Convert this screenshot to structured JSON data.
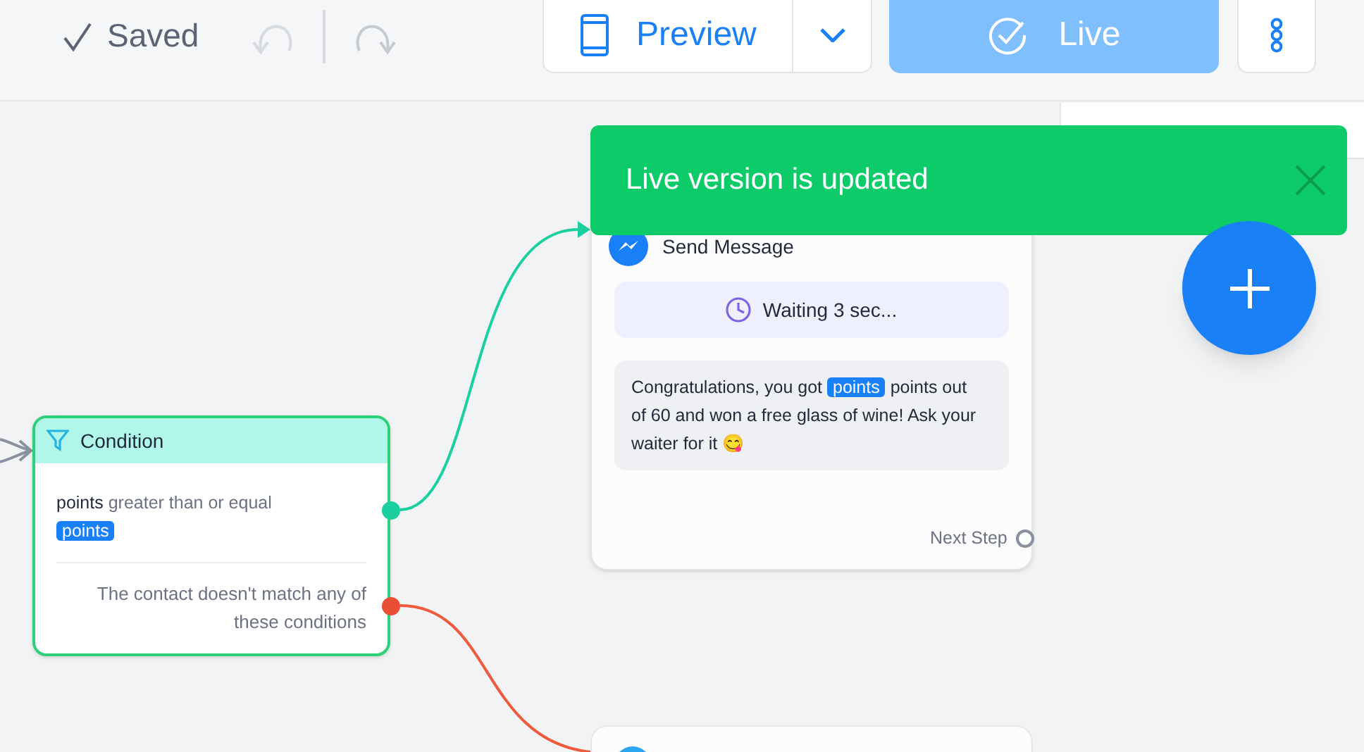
{
  "toolbar": {
    "save_status": "Saved",
    "preview_button": "Preview",
    "live_button": "Live"
  },
  "toast": {
    "message": "Live version is updated"
  },
  "condition_node": {
    "title": "Condition",
    "rule": [
      {
        "kind": "field",
        "text": "points"
      },
      {
        "kind": "text",
        "text": "greater than or equal"
      },
      {
        "kind": "variable",
        "text": "points"
      }
    ],
    "fallback": "The contact doesn't match any of these conditions"
  },
  "message_node": {
    "title": "Send Message",
    "delay": "Waiting 3 sec...",
    "message": [
      {
        "kind": "text",
        "text": "Congratulations, you got"
      },
      {
        "kind": "variable",
        "text": "points"
      },
      {
        "kind": "text",
        "text": "points out of 60 and won a free glass of wine! Ask your waiter for it 😋"
      }
    ],
    "next_step": "Next Step"
  }
}
